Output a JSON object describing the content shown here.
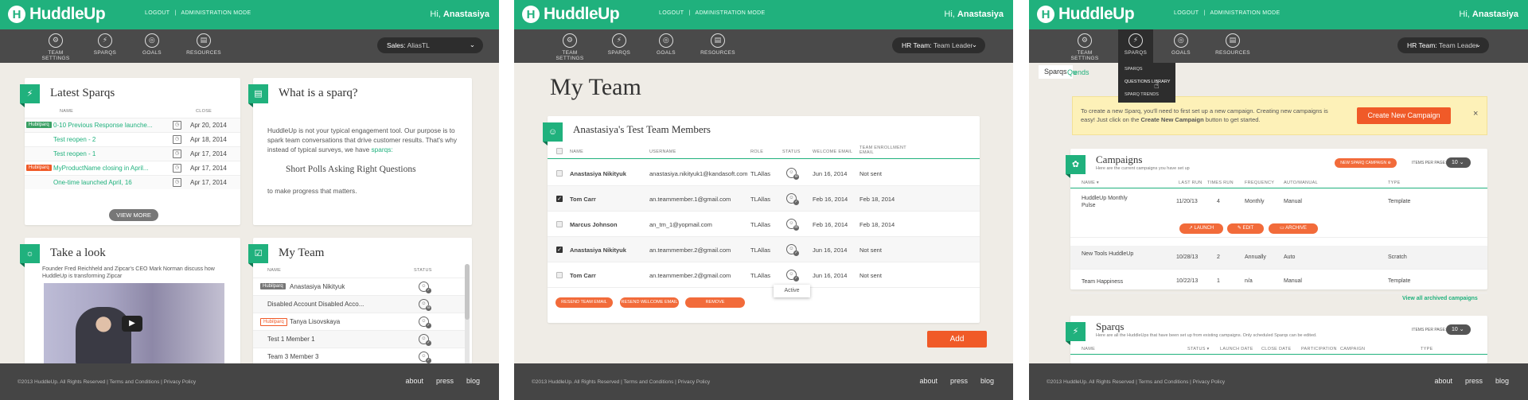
{
  "brand": {
    "logo_mark": "H",
    "logo_text": "HuddleUp"
  },
  "top": {
    "logout": "LOGOUT",
    "admin": "ADMINISTRATION MODE",
    "greeting_prefix": "Hi,",
    "user": "Anastasiya"
  },
  "nav": {
    "team_settings": "TEAM SETTINGS",
    "sparqs": "SPARQS",
    "goals": "GOALS",
    "resources": "RESOURCES"
  },
  "footer": {
    "copyright": "©2013 HuddleUp. All Rights Reserved  |  Terms and Conditions  |  Privacy Policy",
    "about": "about",
    "press": "press",
    "blog": "blog"
  },
  "panel1": {
    "team_select_label": "Sales:",
    "team_select_value": "AliasTL",
    "latest": {
      "title": "Latest Sparqs",
      "col_name": "NAME",
      "col_close": "CLOSE",
      "rows": [
        {
          "tag": "Hubilparq",
          "name": "0-10 Previous Response launche...",
          "date": "Apr 20, 2014"
        },
        {
          "tag": "",
          "name": "Test reopen - 2",
          "date": "Apr 18, 2014"
        },
        {
          "tag": "",
          "name": "Test reopen - 1",
          "date": "Apr 17, 2014"
        },
        {
          "tag": "Hubilparq",
          "name": "MyProductName closing in April...",
          "date": "Apr 17, 2014"
        },
        {
          "tag": "",
          "name": "One-time launched April, 16",
          "date": "Apr 17, 2014"
        }
      ],
      "view_more": "VIEW MORE"
    },
    "what": {
      "title": "What is a sparq?",
      "p1": "HuddleUp is not your typical engagement tool. Our purpose is to spark team conversations that drive customer results. That's why instead of typical surveys, we have",
      "p1_link": "sparqs:",
      "acronym": "Short Polls Asking Right Questions",
      "p2": "to make progress that matters."
    },
    "take": {
      "title": "Take a look",
      "desc": "Founder Fred Reichheld and Zipcar's CEO Mark Norman discuss how HuddleUp is transforming Zipcar"
    },
    "myteam": {
      "title": "My Team",
      "col_name": "NAME",
      "col_status": "STATUS",
      "rows": [
        {
          "tag": "Hubilparq",
          "name": "Anastasiya Nikityuk"
        },
        {
          "tag": "",
          "name": "Disabled Account Disabled Acco..."
        },
        {
          "tag": "Hubilparq",
          "name": "Tanya Lisovskaya"
        },
        {
          "tag": "",
          "name": "Test 1 Member 1"
        },
        {
          "tag": "",
          "name": "Team 3 Member 3"
        }
      ]
    }
  },
  "panel2": {
    "team_select_label": "HR Team:",
    "team_select_value": "Team Leader",
    "page_title": "My Team",
    "card_title": "Anastasiya's Test Team Members",
    "cols": {
      "name": "NAME",
      "username": "USERNAME",
      "role": "ROLE",
      "status": "STATUS",
      "welcome": "WELCOME EMAIL",
      "enroll": "TEAM ENROLLMENT EMAIL"
    },
    "rows": [
      {
        "checked": false,
        "name": "Anastasiya Nikityuk",
        "username": "anastasiya.nikityuk1@kandasoft.com",
        "role": "TLAllas",
        "welcome": "Jun 16, 2014",
        "enroll": "Not sent"
      },
      {
        "checked": true,
        "name": "Tom Carr",
        "username": "an.teammember.1@gmail.com",
        "role": "TLAllas",
        "welcome": "Feb 16, 2014",
        "enroll": "Feb 18, 2014"
      },
      {
        "checked": false,
        "name": "Marcus Johnson",
        "username": "an_tm_1@yopmail.com",
        "role": "TLAllas",
        "welcome": "Feb 16, 2014",
        "enroll": "Feb 18, 2014"
      },
      {
        "checked": true,
        "name": "Anastasiya Nikityuk",
        "username": "an.teammember.2@gmail.com",
        "role": "TLAllas",
        "welcome": "Jun 16, 2014",
        "enroll": "Not sent"
      },
      {
        "checked": false,
        "name": "Tom Carr",
        "username": "an.teammember.2@gmail.com",
        "role": "TLAllas",
        "welcome": "Jun 16, 2014",
        "enroll": "Not sent"
      }
    ],
    "tooltip": "Active",
    "btn_resend_team": "RESEND TEAM EMAIL",
    "btn_resend_welcome": "RESEND WELCOME EMAIL",
    "btn_remove": "REMOVE",
    "btn_add": "Add"
  },
  "panel3": {
    "team_select_label": "HR Team:",
    "team_select_value": "Team Leader",
    "dropdown": [
      "SPARQS",
      "QUESTIONS LIBRARY",
      "SPARQ TRENDS"
    ],
    "tab_sparqs": "Sparqs",
    "tab_q": "Qu",
    "tab_trends": "rends",
    "notice": "To create a new Sparq, you'll need to first set up a new campaign. Creating new campaigns is easy! Just click on the",
    "notice_bold": "Create New Campaign",
    "notice_tail": "button to get started.",
    "btn_create": "Create New Campaign",
    "close": "×",
    "campaigns": {
      "title": "Campaigns",
      "subtitle": "Here are the current campaigns you have set up",
      "btn_new": "NEW SPARQ CAMPAIGN",
      "items_label": "ITEMS PER PAGE:",
      "items_value": "10",
      "cols": {
        "name": "NAME",
        "last": "LAST RUN",
        "times": "TIMES RUN",
        "freq": "FREQUENCY",
        "auto": "AUTO/MANUAL",
        "type": "TYPE"
      },
      "rows": [
        {
          "name": "HuddleUp Monthly Pulse",
          "last": "11/20/13",
          "times": "4",
          "freq": "Monthly",
          "auto": "Manual",
          "type": "Template"
        },
        {
          "name": "New Tools HuddleUp",
          "last": "10/28/13",
          "times": "2",
          "freq": "Annually",
          "auto": "Auto",
          "type": "Scratch"
        },
        {
          "name": "Team Happiness",
          "last": "10/22/13",
          "times": "1",
          "freq": "n/a",
          "auto": "Manual",
          "type": "Template"
        }
      ],
      "btn_launch": "LAUNCH",
      "btn_edit": "EDIT",
      "btn_archive": "ARCHIVE",
      "view_archived": "View all archived campaigns"
    },
    "sparqs": {
      "title": "Sparqs",
      "subtitle": "Here are all the HuddleUps that have been set up from existing campaigns. Only scheduled Sparqs can be edited.",
      "items_label": "ITEMS PER PAGE:",
      "items_value": "10",
      "cols": {
        "name": "NAME",
        "status": "STATUS",
        "launch": "LAUNCH DATE",
        "close": "CLOSE DATE",
        "part": "PARTICIPATION",
        "camp": "CAMPAIGN",
        "type": "TYPE"
      }
    }
  }
}
